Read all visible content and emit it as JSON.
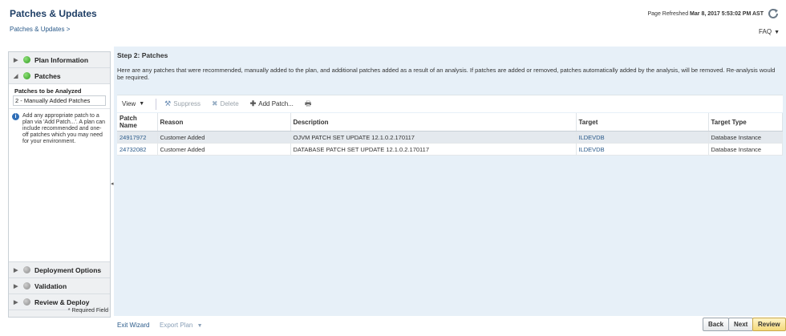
{
  "header": {
    "title": "Patches & Updates",
    "breadcrumb": "Patches & Updates >",
    "refreshed_label": "Page Refreshed",
    "refreshed_time": "Mar 8, 2017 5:53:02 PM AST",
    "faq": "FAQ",
    "refresh_icon": "refresh-icon"
  },
  "left_panel": {
    "steps_top": [
      {
        "label": "Plan Information",
        "status": "green",
        "expanded": false
      },
      {
        "label": "Patches",
        "status": "green",
        "expanded": true
      }
    ],
    "sub_items": [
      "Patches to be Analyzed",
      "2 - Manually Added Patches"
    ],
    "help_text": "Add any appropriate patch to a plan via 'Add Patch...'. A plan can include recommended and one-off patches which you may need for your environment.",
    "steps_bottom": [
      {
        "label": "Deployment Options",
        "status": "gray"
      },
      {
        "label": "Validation",
        "status": "gray"
      },
      {
        "label": "Review & Deploy",
        "status": "gray"
      }
    ],
    "required_note": "* Required Field"
  },
  "main": {
    "step_title": "Step 2: Patches",
    "intro": "Here are any patches that were recommended, manually added to the plan, and additional patches added as a result of an analysis. If patches are added or removed, patches automatically added by the analysis, will be removed. Re-analysis would be required.",
    "toolbar": {
      "view": "View",
      "suppress": "Suppress",
      "delete": "Delete",
      "add_patch": "Add Patch..."
    },
    "columns": [
      "Patch Name",
      "Reason",
      "Description",
      "Target",
      "Target Type"
    ],
    "rows": [
      {
        "patch": "24917972",
        "reason": "Customer Added",
        "description": "OJVM PATCH SET UPDATE 12.1.0.2.170117",
        "target": "ILDEVDB",
        "type": "Database Instance"
      },
      {
        "patch": "24732082",
        "reason": "Customer Added",
        "description": "DATABASE PATCH SET UPDATE 12.1.0.2.170117",
        "target": "ILDEVDB",
        "type": "Database Instance"
      }
    ]
  },
  "footer": {
    "exit": "Exit Wizard",
    "export": "Export Plan",
    "back": "Back",
    "next": "Next",
    "review": "Review"
  }
}
